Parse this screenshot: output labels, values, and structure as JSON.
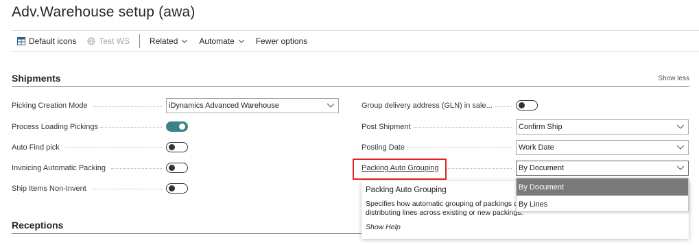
{
  "page": {
    "title": "Adv.Warehouse setup (awa)"
  },
  "toolbar": {
    "default_icons": "Default icons",
    "test_ws": "Test WS",
    "related": "Related",
    "automate": "Automate",
    "fewer_options": "Fewer options"
  },
  "shipments": {
    "title": "Shipments",
    "show_less": "Show less",
    "left": [
      {
        "label": "Picking Creation Mode",
        "type": "select",
        "value": "iDynamics Advanced Warehouse"
      },
      {
        "label": "Process Loading Pickings",
        "type": "toggle",
        "value": true
      },
      {
        "label": "Auto Find pick",
        "type": "toggle",
        "value": false
      },
      {
        "label": "Invoicing Automatic Packing",
        "type": "toggle",
        "value": false
      },
      {
        "label": "Ship Items Non-Invent",
        "type": "toggle",
        "value": false
      }
    ],
    "right": [
      {
        "label": "Group delivery address (GLN) in sale...",
        "type": "toggle",
        "value": false
      },
      {
        "label": "Post Shipment",
        "type": "select",
        "value": "Confirm Ship"
      },
      {
        "label": "Posting Date",
        "type": "select",
        "value": "Work Date"
      },
      {
        "label": "Packing Auto Grouping",
        "type": "select",
        "value": "By Document"
      }
    ]
  },
  "tooltip": {
    "title": "Packing Auto Grouping",
    "body": "Specifies how automatic grouping of packings documents or by distributing lines across existing or new packings.",
    "help": "Show Help"
  },
  "dropdown": {
    "options": [
      "By Document",
      "By Lines"
    ],
    "selected": "By Document"
  },
  "receptions": {
    "title": "Receptions"
  },
  "colors": {
    "toggle_on": "#3b8287",
    "highlight": "#e32323",
    "dropdown_selected": "#7a7a7a"
  }
}
